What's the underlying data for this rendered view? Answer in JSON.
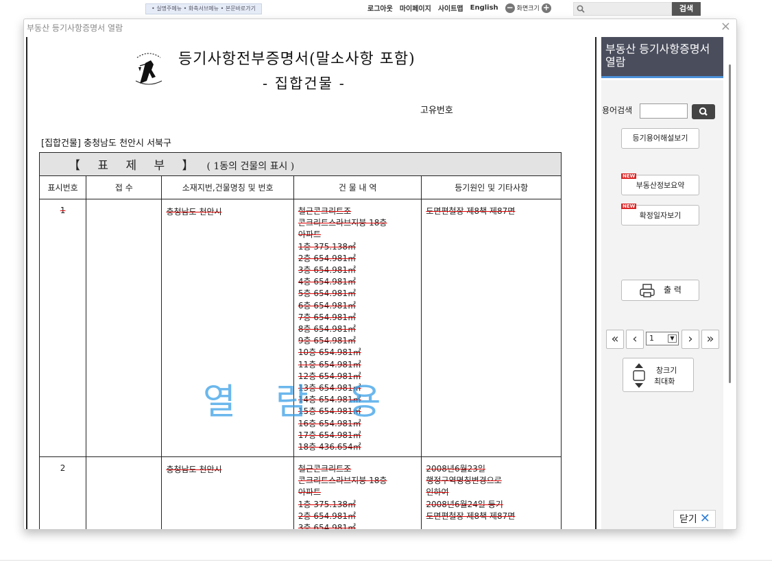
{
  "topbar": {
    "skip_links": "• 실명주메뉴 • 화축서브메뉴 • 본문바로가기",
    "logout": "로그아웃",
    "mypage": "마이페이지",
    "sitemap": "사이트맵",
    "english": "English",
    "zoom_label": "화면크기",
    "search_button": "검색"
  },
  "dialog": {
    "title": "부동산 등기사항증명서 열람"
  },
  "document": {
    "title": "등기사항전부증명서(말소사항 포함)",
    "subtitle": "- 집합건물 -",
    "unique_number_label": "고유번호",
    "address_line": "[집합건물] 충청남도 천안시 서북구",
    "section_title": "【  표  제  부  】",
    "section_subtitle": "( 1동의 건물의 표시 )",
    "columns": [
      "표시번호",
      "접 수",
      "소재지번,건물명칭 및 번호",
      "건 물 내 역",
      "등기원인 및 기타사항"
    ],
    "rows": [
      {
        "num": "1",
        "receipt": "",
        "location": "충청남도 천안시",
        "building": [
          "철근콘크리트조",
          "콘크리트스라브지붕 18층",
          "아파트",
          "1층 375.138㎡",
          "2층 654.981㎡",
          "3층 654.981㎡",
          "4층 654.981㎡",
          "5층 654.981㎡",
          "6층 654.981㎡",
          "7층 654.981㎡",
          "8층 654.981㎡",
          "9층 654.981㎡",
          "10층 654.981㎡",
          "11층 654.981㎡",
          "12층 654.981㎡",
          "13층 654.981㎡",
          "14층 654.981㎡",
          "15층 654.981㎡",
          "16층 654.981㎡",
          "17층 654.981㎡",
          "18층 436.654㎡"
        ],
        "cause": [
          "도면편철장 제8책 제87면"
        ]
      },
      {
        "num": "2",
        "receipt": "",
        "location": "충청남도 천안시",
        "building": [
          "철근콘크리트조",
          "콘크리트스라브지붕 18층",
          "아파트",
          "1층 375.138㎡",
          "2층 654.981㎡",
          "3층 654.981㎡"
        ],
        "cause": [
          "2008년6월23일",
          "행정구역명칭변경으로",
          "인하여",
          "2008년6월24일   등기",
          "도면편철장 제8책 제87면"
        ]
      }
    ],
    "watermark": "열람용"
  },
  "side": {
    "header": "부동산 등기사항증명서 열람",
    "term_search_label": "용어검색",
    "term_search_value": "",
    "glossary_button": "등기용어해설보기",
    "new_badge": "NEW",
    "summary_button": "부동산정보요약",
    "confirm_button": "확정일자보기",
    "print_button": "출 력",
    "page_value": "1",
    "maximize_line1": "창크기",
    "maximize_line2": "최대화",
    "close_button": "닫기"
  }
}
